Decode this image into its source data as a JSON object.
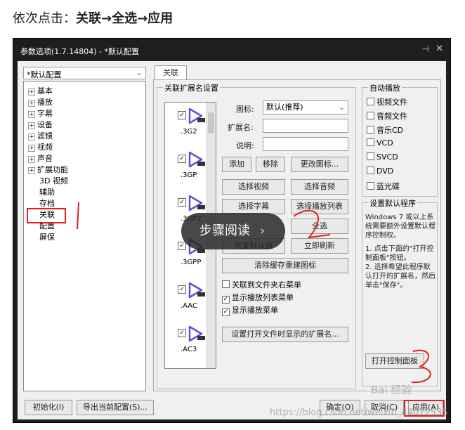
{
  "instruction": {
    "prefix": "依次点击：",
    "path": "关联→全选→应用"
  },
  "window": {
    "title": "参数选项(1.7.14804) - *默认配置",
    "pin_icon": "pin-icon",
    "close_icon": "close-icon"
  },
  "profile_select": {
    "value": "*默认配置"
  },
  "tree": [
    {
      "label": "基本",
      "expandable": true
    },
    {
      "label": "播放",
      "expandable": true
    },
    {
      "label": "字幕",
      "expandable": true
    },
    {
      "label": "设备",
      "expandable": true
    },
    {
      "label": "滤镜",
      "expandable": true
    },
    {
      "label": "视频",
      "expandable": true
    },
    {
      "label": "声音",
      "expandable": true
    },
    {
      "label": "扩展功能",
      "expandable": true
    },
    {
      "label": "3D 视频",
      "expandable": false
    },
    {
      "label": "辅助",
      "expandable": false
    },
    {
      "label": "存档",
      "expandable": false
    },
    {
      "label": "关联",
      "expandable": false,
      "selected": true
    },
    {
      "label": "配置",
      "expandable": false
    },
    {
      "label": "屏保",
      "expandable": false
    }
  ],
  "tab": {
    "label": "关联"
  },
  "ext_group": {
    "title": "关联扩展名设置"
  },
  "file_list": [
    {
      "ext": ".3G2",
      "checked": true
    },
    {
      "ext": ".3GP",
      "checked": true
    },
    {
      "ext": ".3GP2",
      "checked": true
    },
    {
      "ext": ".3GPP",
      "checked": true
    },
    {
      "ext": ".AAC",
      "checked": true
    },
    {
      "ext": ".AC3",
      "checked": true
    }
  ],
  "form": {
    "icon_label": "图标:",
    "icon_value": "默认(推荐)",
    "ext_label": "扩展名:",
    "ext_value": "",
    "desc_label": "说明:",
    "desc_value": ""
  },
  "buttons": {
    "add": "添加",
    "remove": "移除",
    "change_icon": "更改图标...",
    "select_video": "选择视频",
    "select_audio": "选择音频",
    "select_subtitle": "选择字幕",
    "select_playlist": "选择播放列表",
    "select_all": "全选",
    "restore_default": "恢复默认值",
    "refresh": "立即刷新",
    "clear_cache": "清除缓存重建图标",
    "set_open_ext": "设置打开文件时显示的扩展名...",
    "open_control_panel": "打开控制面板",
    "init": "初始化(I)",
    "export": "导出当前配置(S)...",
    "ok": "确定(O)",
    "cancel": "取消(C)",
    "apply": "应用(A)"
  },
  "menu_options": [
    {
      "label": "关联到文件夹右菜单",
      "checked": false
    },
    {
      "label": "显示播放列表菜单",
      "checked": true
    },
    {
      "label": "显示播放菜单",
      "checked": true
    }
  ],
  "autoplay": {
    "title": "自动播放",
    "items": [
      {
        "label": "视频文件",
        "checked": false
      },
      {
        "label": "音频文件",
        "checked": false
      },
      {
        "label": "音乐CD",
        "checked": false
      },
      {
        "label": "VCD",
        "checked": false
      },
      {
        "label": "SVCD",
        "checked": false
      },
      {
        "label": "DVD",
        "checked": false
      },
      {
        "label": "蓝光碟",
        "checked": false
      }
    ]
  },
  "default_program": {
    "title": "设置默认程序",
    "text1": "Windows 7 或以上系统需要额外设置默认程序控制权。",
    "text2": "1. 点击下面的\"打开控制面板\"按钮。",
    "text3": "2. 选择希望此程序默认打开的扩展名，然后单击\"保存\"。"
  },
  "overlay": {
    "label": "步骤阅读",
    "arrow": "›"
  },
  "watermark": {
    "text": "https://blog.csdn.net/weixin_44072535",
    "logo": "Bai 经验"
  },
  "colors": {
    "accent": "#e02020",
    "window_bg": "#1e1e1e",
    "panel_bg": "#f0f0f0"
  }
}
